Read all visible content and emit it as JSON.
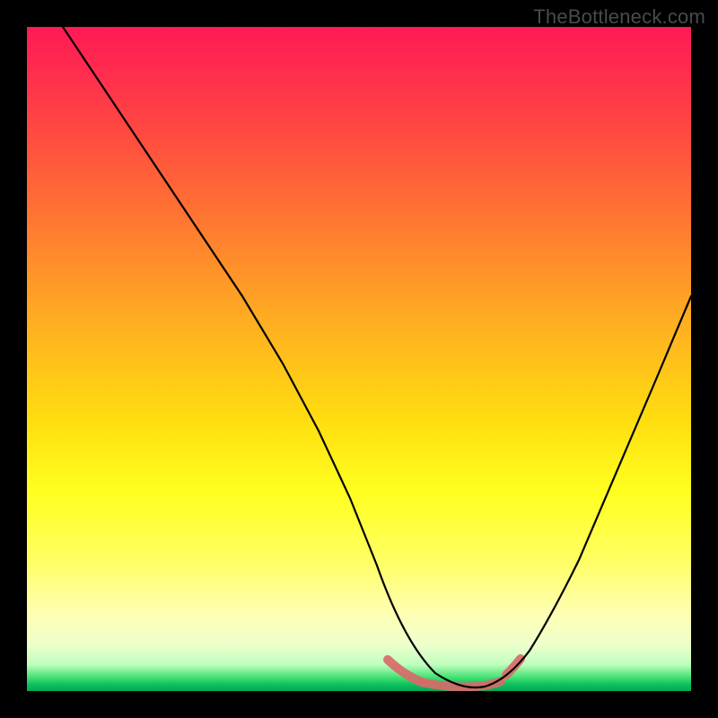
{
  "watermark": "TheBottleneck.com",
  "colors": {
    "background": "#000000",
    "curve": "#000000",
    "highlight": "#d86a6a",
    "watermark_text": "#4a4a4a"
  },
  "chart_data": {
    "type": "line",
    "title": "",
    "xlabel": "",
    "ylabel": "",
    "xlim": [
      0,
      100
    ],
    "ylim": [
      0,
      100
    ],
    "x": [
      0,
      5,
      10,
      15,
      20,
      25,
      30,
      35,
      40,
      45,
      50,
      55,
      58,
      60,
      62,
      65,
      68,
      70,
      75,
      80,
      85,
      90,
      95,
      100
    ],
    "series": [
      {
        "name": "bottleneck",
        "values": [
          100,
          92,
          83,
          74,
          65,
          56,
          47,
          38,
          29,
          20,
          12,
          5,
          2,
          1,
          0,
          0,
          1,
          3,
          10,
          20,
          32,
          45,
          58,
          72
        ]
      }
    ],
    "highlight_range": {
      "x_start": 55,
      "x_end": 70
    },
    "grid": false,
    "legend": false
  }
}
